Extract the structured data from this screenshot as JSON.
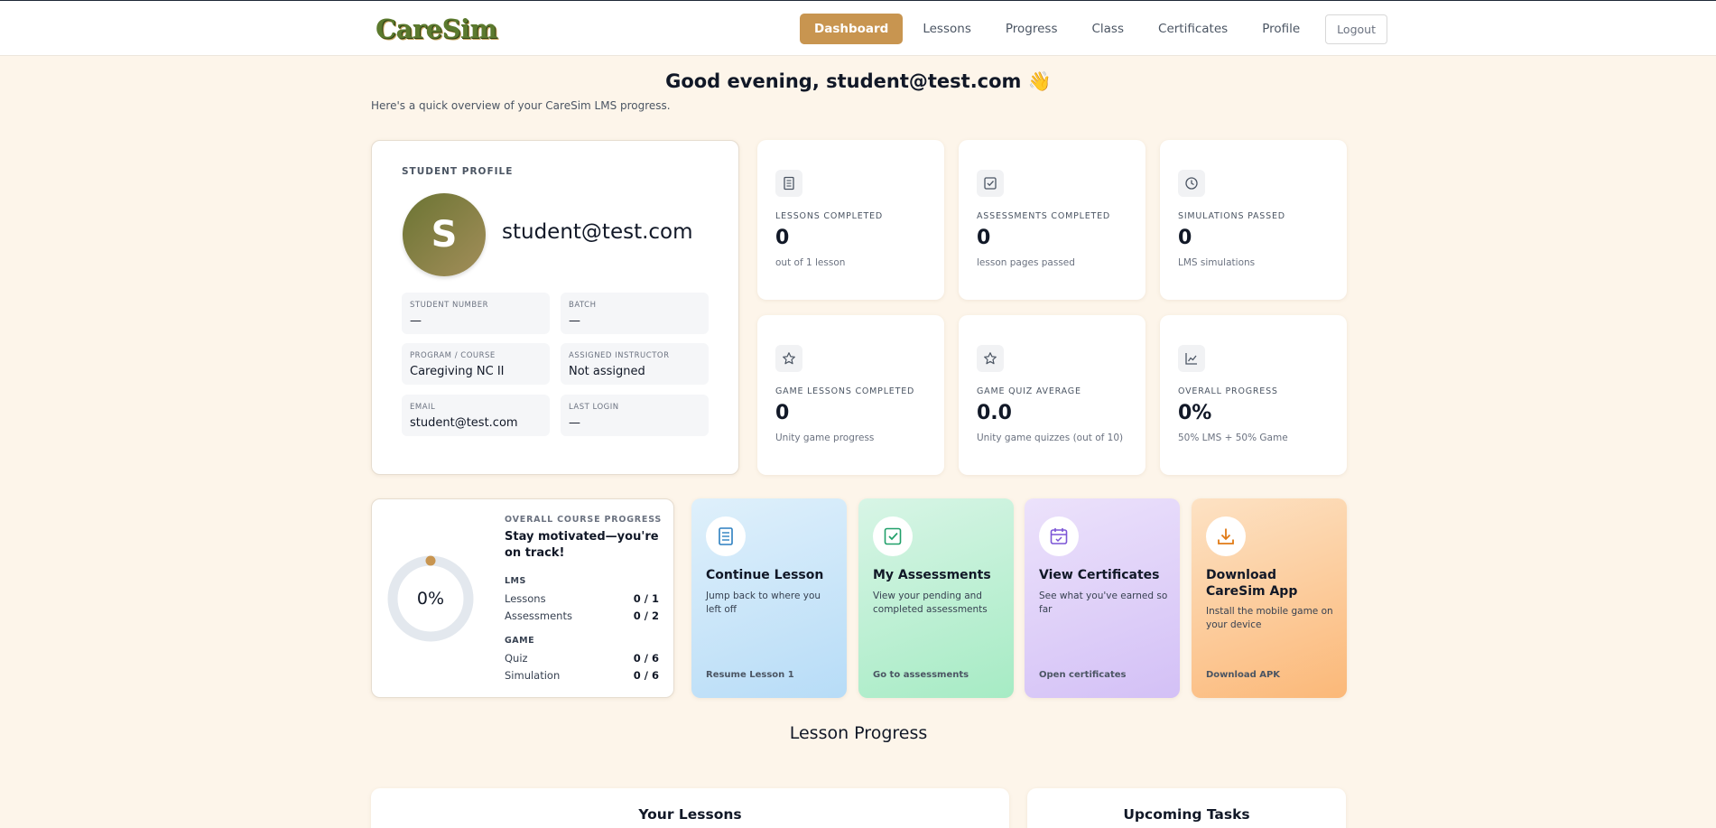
{
  "nav": {
    "logo": "CareSim",
    "links": [
      "Dashboard",
      "Lessons",
      "Progress",
      "Class",
      "Certificates",
      "Profile"
    ],
    "logout": "Logout"
  },
  "header": {
    "greeting": "Good evening, student@test.com 👋",
    "subtitle": "Here's a quick overview of your CareSim LMS progress."
  },
  "profile": {
    "section_label": "STUDENT PROFILE",
    "avatar_initial": "S",
    "name": "student@test.com",
    "fields": [
      {
        "label": "STUDENT NUMBER",
        "value": "—"
      },
      {
        "label": "BATCH",
        "value": "—"
      },
      {
        "label": "PROGRAM / COURSE",
        "value": "Caregiving NC II"
      },
      {
        "label": "ASSIGNED INSTRUCTOR",
        "value": "Not assigned"
      },
      {
        "label": "EMAIL",
        "value": "student@test.com"
      },
      {
        "label": "LAST LOGIN",
        "value": "—"
      }
    ]
  },
  "stats": [
    {
      "icon": "book-icon",
      "label": "LESSONS COMPLETED",
      "value": "0",
      "sub": "out of 1 lesson"
    },
    {
      "icon": "checkbox-icon",
      "label": "ASSESSMENTS COMPLETED",
      "value": "0",
      "sub": "lesson pages passed"
    },
    {
      "icon": "clock-icon",
      "label": "SIMULATIONS PASSED",
      "value": "0",
      "sub": "LMS simulations"
    },
    {
      "icon": "star-icon",
      "label": "GAME LESSONS COMPLETED",
      "value": "0",
      "sub": "Unity game progress"
    },
    {
      "icon": "star-icon",
      "label": "GAME QUIZ AVERAGE",
      "value": "0.0",
      "sub": "Unity game quizzes (out of 10)"
    },
    {
      "icon": "chart-icon",
      "label": "OVERALL PROGRESS",
      "value": "0%",
      "sub": "50% LMS + 50% Game"
    }
  ],
  "course_progress": {
    "percent_text": "0%",
    "percent_value": 0,
    "label": "OVERALL COURSE PROGRESS",
    "motivation": "Stay motivated—you're on track!",
    "lms_label": "LMS",
    "lessons_label": "Lessons",
    "lessons_value": "0 / 1",
    "assessments_label": "Assessments",
    "assessments_value": "0 / 2",
    "game_label": "GAME",
    "quiz_label": "Quiz",
    "quiz_value": "0 / 6",
    "simulation_label": "Simulation",
    "simulation_value": "0 / 6"
  },
  "actions": [
    {
      "icon": "book-icon",
      "title": "Continue Lesson",
      "desc": "Jump back to where you left off",
      "link": "Resume Lesson 1",
      "bg_from": "#dff0fb",
      "bg_to": "#b7dcf7",
      "accent": "#2b7fc0"
    },
    {
      "icon": "checkbox-icon",
      "title": "My Assessments",
      "desc": "View your pending and completed assessments",
      "link": "Go to assessments",
      "bg_from": "#d8f5e6",
      "bg_to": "#a6ebc4",
      "accent": "#21a06a"
    },
    {
      "icon": "calendar-icon",
      "title": "View Certificates",
      "desc": "See what you've earned so far",
      "link": "Open certificates",
      "bg_from": "#ece2fb",
      "bg_to": "#d3c0f6",
      "accent": "#7c55d6"
    },
    {
      "icon": "download-icon",
      "title": "Download CareSim App",
      "desc": "Install the mobile game on your device",
      "link": "Download APK",
      "bg_from": "#fde2c4",
      "bg_to": "#fbb878",
      "accent": "#e07a16"
    }
  ],
  "sections": {
    "lesson_progress": "Lesson Progress",
    "your_lessons": "Your Lessons",
    "upcoming_tasks": "Upcoming Tasks"
  }
}
